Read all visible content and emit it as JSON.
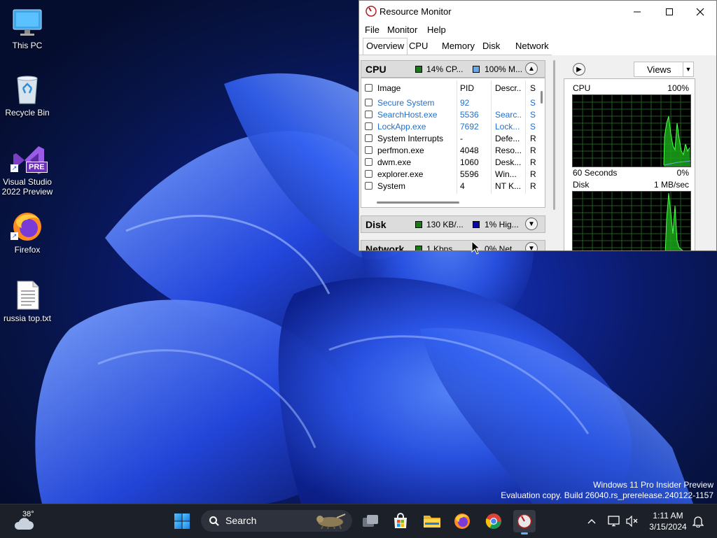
{
  "desktop": {
    "icons": [
      {
        "label": "This PC",
        "icon": "monitor-icon"
      },
      {
        "label": "Recycle Bin",
        "icon": "recycle-bin-icon"
      },
      {
        "label": "Visual Studio\n2022 Preview",
        "line1": "Visual Studio",
        "line2": "2022 Preview",
        "icon": "visual-studio-icon",
        "badge": "PRE"
      },
      {
        "label": "Firefox",
        "icon": "firefox-icon"
      },
      {
        "label": "russia top.txt",
        "icon": "text-file-icon"
      }
    ],
    "watermark": {
      "line1": "Windows 11 Pro Insider Preview",
      "line2": "Evaluation copy. Build 26040.rs_prerelease.240122-1157"
    }
  },
  "window": {
    "title": "Resource Monitor",
    "menu": [
      "File",
      "Monitor",
      "Help"
    ],
    "tabs": [
      "Overview",
      "CPU",
      "Memory",
      "Disk",
      "Network"
    ],
    "active_tab": "Overview",
    "cpu_panel": {
      "name": "CPU",
      "stat1": "14% CP...",
      "stat2": "100% M...",
      "columns": [
        "Image",
        "PID",
        "Descr...",
        "S"
      ],
      "rows": [
        {
          "image": "Secure System",
          "pid": "92",
          "desc": "",
          "status": "S",
          "suspended": true
        },
        {
          "image": "SearchHost.exe",
          "pid": "5536",
          "desc": "Searc...",
          "status": "S",
          "suspended": true
        },
        {
          "image": "LockApp.exe",
          "pid": "7692",
          "desc": "Lock...",
          "status": "S",
          "suspended": true
        },
        {
          "image": "System Interrupts",
          "pid": "-",
          "desc": "Defe...",
          "status": "R",
          "suspended": false
        },
        {
          "image": "perfmon.exe",
          "pid": "4048",
          "desc": "Reso...",
          "status": "R",
          "suspended": false
        },
        {
          "image": "dwm.exe",
          "pid": "1060",
          "desc": "Desk...",
          "status": "R",
          "suspended": false
        },
        {
          "image": "explorer.exe",
          "pid": "5596",
          "desc": "Win...",
          "status": "R",
          "suspended": false
        },
        {
          "image": "System",
          "pid": "4",
          "desc": "NT K...",
          "status": "R",
          "suspended": false
        }
      ]
    },
    "disk_panel": {
      "name": "Disk",
      "stat1": "130 KB/...",
      "stat2": "1% Hig..."
    },
    "network_panel": {
      "name": "Network",
      "stat1": "1 Kbps ...",
      "stat2": "0% Net..."
    },
    "graphs": {
      "views_label": "Views",
      "cpu": {
        "label": "CPU",
        "max": "100%",
        "footer_left": "60 Seconds",
        "footer_right": "0%"
      },
      "disk": {
        "label": "Disk",
        "max": "1 MB/sec"
      }
    },
    "colors": {
      "cpu_usage": "#1a7a1a",
      "cpu_freq": "#6aa8e6",
      "disk_io": "#1a7a1a",
      "disk_active": "#0a0aa0",
      "graph_line": "#2ee82e"
    }
  },
  "taskbar": {
    "weather": {
      "temp": "38°",
      "icon": "cloud-weather-icon"
    },
    "search_placeholder": "Search",
    "apps": [
      "start",
      "search",
      "task-view",
      "store",
      "file-explorer",
      "firefox",
      "chrome",
      "resource-monitor"
    ],
    "clock": {
      "time": "1:11 AM",
      "date": "3/15/2024"
    }
  }
}
